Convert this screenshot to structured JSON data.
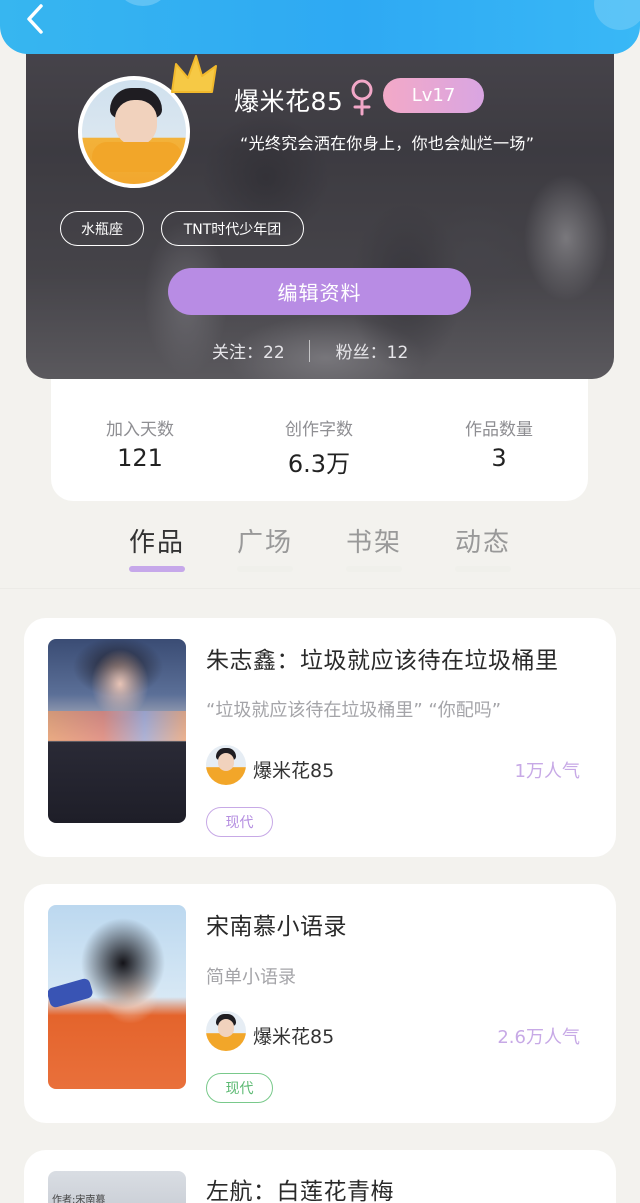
{
  "header": {
    "back_icon": "chevron-left-icon",
    "bar_color": "#2ea9f3"
  },
  "profile": {
    "username": "爆米花85",
    "gender_symbol": "♀",
    "level": "Lv17",
    "signature": "“光终究会洒在你身上，你也会灿烂一场”",
    "tags": [
      "水瓶座",
      "TNT时代少年团"
    ],
    "edit_label": "编辑资料",
    "following_label": "关注：",
    "following_count": "22",
    "followers_label": "粉丝：",
    "followers_count": "12",
    "accent_color": "#b88ce4"
  },
  "stats": [
    {
      "label": "加入天数",
      "value": "121"
    },
    {
      "label": "创作字数",
      "value": "6.3万"
    },
    {
      "label": "作品数量",
      "value": "3"
    }
  ],
  "tabs": [
    {
      "label": "作品",
      "active": true
    },
    {
      "label": "广场",
      "active": false
    },
    {
      "label": "书架",
      "active": false
    },
    {
      "label": "动态",
      "active": false
    }
  ],
  "works": [
    {
      "title": "朱志鑫：垃圾就应该待在垃圾桶里",
      "desc": "“垃圾就应该待在垃圾桶里” “你配吗”",
      "author": "爆米花85",
      "popularity": "1万人气",
      "genre": "现代"
    },
    {
      "title": "宋南慕小语录",
      "desc": "简单小语录",
      "author": "爆米花85",
      "popularity": "2.6万人气",
      "genre": "现代"
    },
    {
      "title": "左航：白莲花青梅",
      "cover_text": "作者:宋南慕"
    }
  ]
}
